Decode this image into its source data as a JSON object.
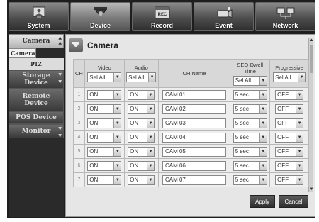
{
  "top_menu": {
    "tabs": [
      {
        "label": "System",
        "icon": "monitor-user-icon"
      },
      {
        "label": "Device",
        "icon": "dome-camera-icon"
      },
      {
        "label": "Record",
        "icon": "record-film-icon"
      },
      {
        "label": "Event",
        "icon": "event-camera-icon"
      },
      {
        "label": "Network",
        "icon": "network-computers-icon"
      }
    ],
    "active": "Device"
  },
  "sidebar": {
    "section_label": "Camera",
    "sub_items": [
      "Camera",
      "PTZ"
    ],
    "items": [
      "Storage Device",
      "Remote Device",
      "POS Device",
      "Monitor"
    ]
  },
  "panel": {
    "title": "Camera",
    "headers": {
      "ch": "CH",
      "video": "Video",
      "audio": "Audio",
      "ch_name": "CH Name",
      "seq_dwell": "SEQ-Dwell Time",
      "progressive": "Progressive"
    },
    "header_selects": {
      "video": "Sel All",
      "audio": "Sel All",
      "seq_dwell": "Sel All",
      "progressive": "Sel All"
    },
    "rows": [
      {
        "ch": "1",
        "video": "ON",
        "audio": "ON",
        "name": "CAM 01",
        "dwell": "5 sec",
        "progressive": "OFF"
      },
      {
        "ch": "2",
        "video": "ON",
        "audio": "ON",
        "name": "CAM 02",
        "dwell": "5 sec",
        "progressive": "OFF"
      },
      {
        "ch": "3",
        "video": "ON",
        "audio": "ON",
        "name": "CAM 03",
        "dwell": "5 sec",
        "progressive": "OFF"
      },
      {
        "ch": "4",
        "video": "ON",
        "audio": "ON",
        "name": "CAM 04",
        "dwell": "5 sec",
        "progressive": "OFF"
      },
      {
        "ch": "5",
        "video": "ON",
        "audio": "ON",
        "name": "CAM 05",
        "dwell": "5 sec",
        "progressive": "OFF"
      },
      {
        "ch": "6",
        "video": "ON",
        "audio": "ON",
        "name": "CAM 06",
        "dwell": "5 sec",
        "progressive": "OFF"
      },
      {
        "ch": "7",
        "video": "ON",
        "audio": "ON",
        "name": "CAM 07",
        "dwell": "5 sec",
        "progressive": "OFF"
      }
    ],
    "buttons": {
      "apply": "Apply",
      "cancel": "Cancel"
    }
  }
}
